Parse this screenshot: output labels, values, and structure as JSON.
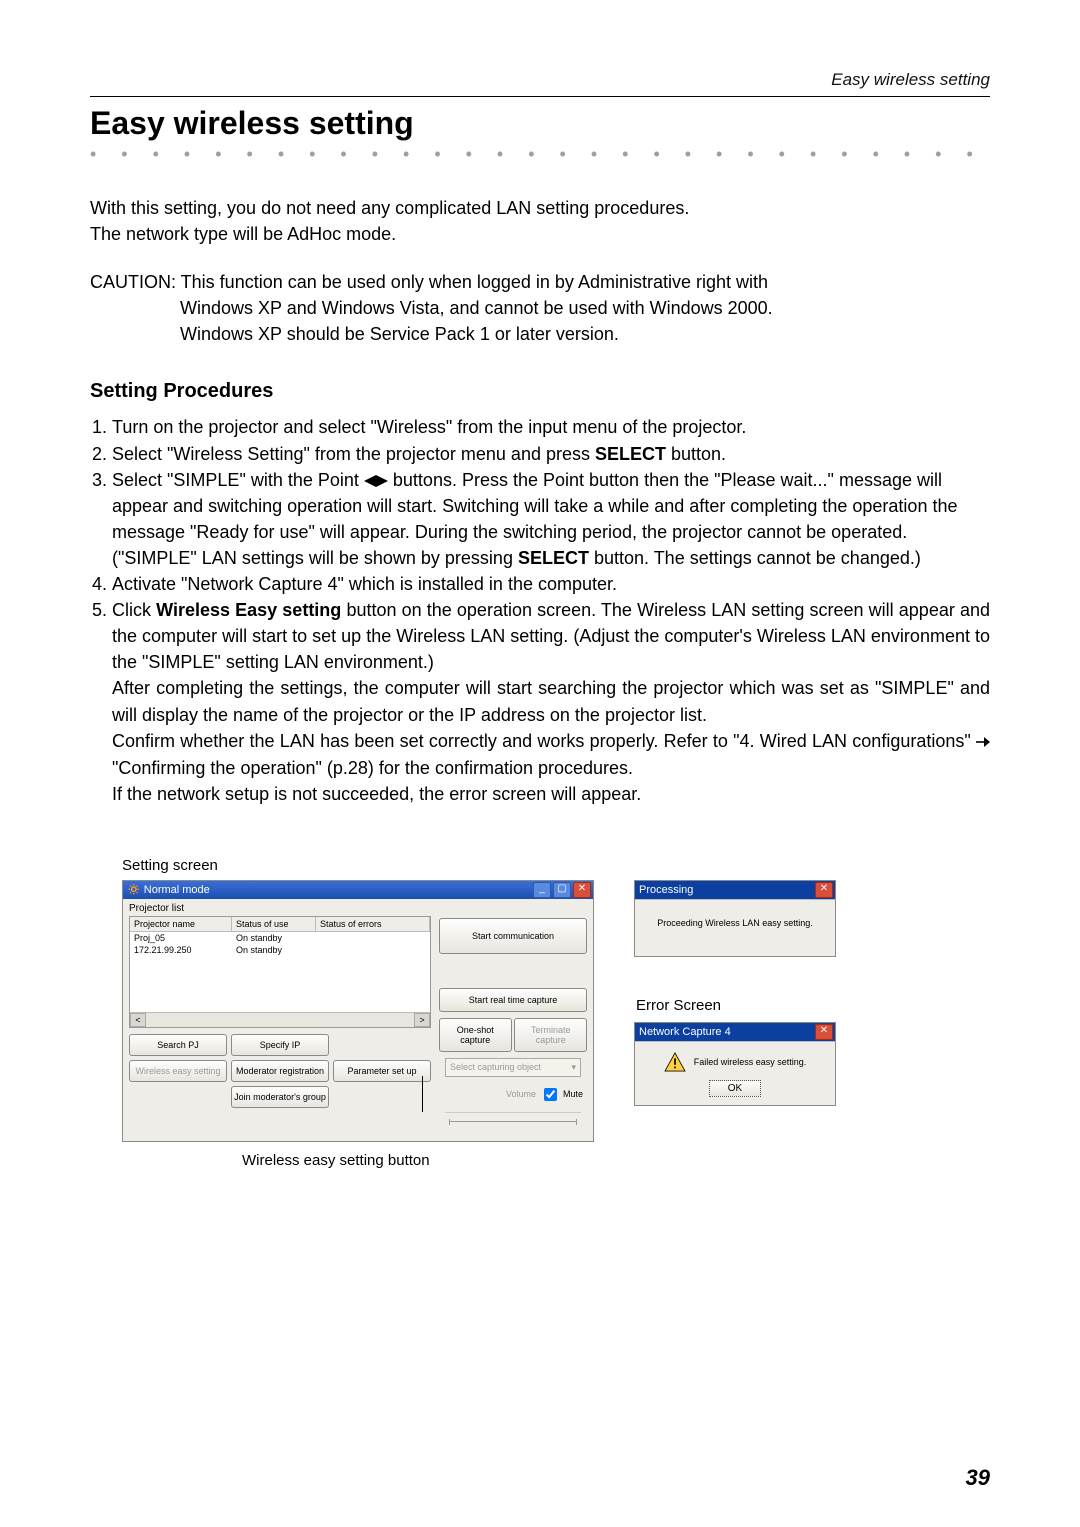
{
  "header": {
    "running": "Easy wireless setting"
  },
  "title": "Easy wireless setting",
  "intro": {
    "p1a": "With this setting, you do not need any complicated LAN setting procedures.",
    "p1b": "The network type will be AdHoc mode."
  },
  "caution": {
    "l1": "CAUTION: This function can be used only when logged in by Administrative right with",
    "l2": "Windows XP and Windows Vista, and cannot be used with Windows 2000.",
    "l3": "Windows XP should be Service Pack 1 or later version."
  },
  "subheading": "Setting Procedures",
  "steps": {
    "s1": "Turn on the projector and select \"Wireless\" from the input menu of the projector.",
    "s2a": "Select \"Wireless Setting\" from the projector menu and press ",
    "s2b": "SELECT",
    "s2c": " button.",
    "s3a": "Select \"SIMPLE\" with the Point ",
    "s3b": " buttons. Press the Point button then the \"Please wait...\" message will appear and switching operation will start. Switching will take a while and after completing the operation the message \"Ready for use\" will appear. During the switching period, the projector cannot be operated. (\"SIMPLE\" LAN settings will be shown by pressing ",
    "s3c": "SELECT",
    "s3d": " button. The settings cannot be changed.)",
    "s4": "Activate \"Network Capture 4\" which is installed in the computer.",
    "s5a": "Click ",
    "s5b": "Wireless Easy setting",
    "s5c": " button on the operation screen. The Wireless LAN setting screen will appear and the computer will start to set up the Wireless LAN setting. (Adjust the computer's Wireless LAN environment to the \"SIMPLE\" setting LAN environment.)",
    "s5d": "After completing the settings, the computer will start searching the projector which was set as \"SIMPLE\" and will display the name of the projector or the IP address on the projector list.",
    "s5e": "Confirm whether the LAN has been set correctly and works properly. Refer to \"4. Wired LAN configurations\" ",
    "s5f": " \"Confirming the operation\" (p.28) for the confirmation procedures.",
    "s5g": "If the network setup is not succeeded, the error screen will appear."
  },
  "caption_setting": "Setting screen",
  "setting_window": {
    "title": "Normal mode",
    "projector_list_label": "Projector list",
    "columns": {
      "c1": "Projector name",
      "c2": "Status of use",
      "c3": "Status of errors"
    },
    "rows": [
      {
        "c1": "Proj_05",
        "c2": "On standby"
      },
      {
        "c1": "172.21.99.250",
        "c2": "On standby"
      }
    ],
    "right": {
      "start_comm": "Start communication",
      "start_rt": "Start real time capture",
      "one_shot": "One-shot capture",
      "terminate": "Terminate capture",
      "select_obj": "Select capturing object",
      "volume": "Volume",
      "mute": "Mute"
    },
    "bottom": {
      "search_pj": "Search PJ",
      "specify_ip": "Specify IP",
      "wireless_easy": "Wireless easy setting",
      "moderator": "Moderator registration",
      "join_group": "Join moderator's group",
      "param": "Parameter set up"
    }
  },
  "callout_label": "Wireless easy setting button",
  "processing": {
    "title": "Processing",
    "msg": "Proceeding Wireless LAN easy setting."
  },
  "error": {
    "heading": "Error Screen",
    "title": "Network Capture 4",
    "msg": "Failed wireless easy setting.",
    "ok": "OK"
  },
  "page_number": "39"
}
